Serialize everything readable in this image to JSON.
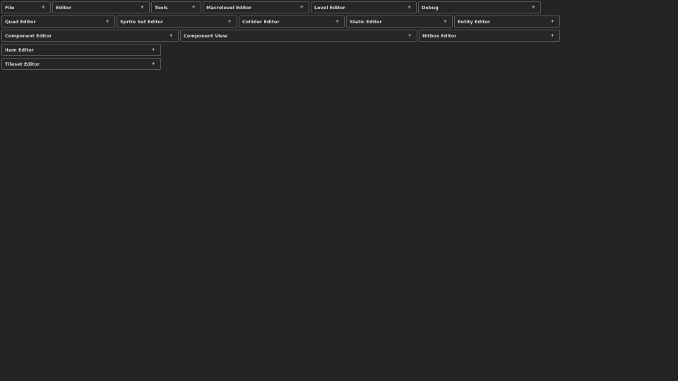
{
  "panels": {
    "file": {
      "label": "File",
      "toggle": "+"
    },
    "editor": {
      "label": "Editor",
      "toggle": "+"
    },
    "tools": {
      "label": "Tools",
      "toggle": "+"
    },
    "macrolevel_editor": {
      "label": "Macrolevel Editor",
      "toggle": "+"
    },
    "level_editor": {
      "label": "Level Editor",
      "toggle": "+"
    },
    "debug": {
      "label": "Debug",
      "toggle": "+"
    },
    "quad_editor": {
      "label": "Quad Editor",
      "toggle": "+"
    },
    "sprite_set_editor": {
      "label": "Sprite Set Editor",
      "toggle": "+"
    },
    "collider_editor": {
      "label": "Collider Editor",
      "toggle": "+"
    },
    "static_editor": {
      "label": "Static Editor",
      "toggle": "+"
    },
    "entity_editor": {
      "label": "Entity Editor",
      "toggle": "+"
    },
    "component_editor": {
      "label": "Component Editor",
      "toggle": "+"
    },
    "component_view": {
      "label": "Component View",
      "toggle": "+"
    },
    "hitbox_editor": {
      "label": "Hitbox Editor",
      "toggle": "+"
    },
    "item_editor": {
      "label": "Item Editor",
      "toggle": "+"
    },
    "tileset_editor": {
      "label": "Tileset Editor",
      "toggle": "+"
    }
  },
  "colors": {
    "background": "#242424",
    "panel_border": "#5a5a5a",
    "text": "#d8d8d8"
  }
}
